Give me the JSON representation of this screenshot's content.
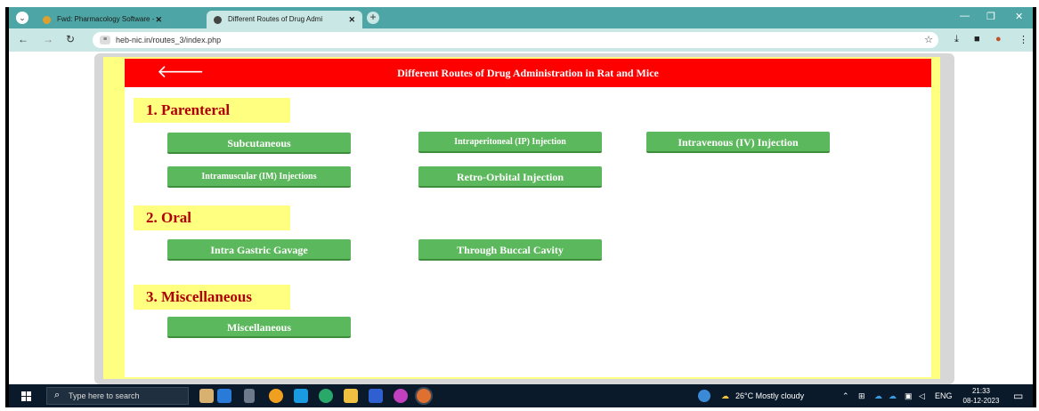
{
  "browser": {
    "tabs": [
      {
        "label": "Fwd: Pharmacology Software - ",
        "close": "✕"
      },
      {
        "label": "Different Routes of Drug Admi",
        "close": "✕"
      }
    ],
    "new_tab": "+",
    "url": "heb-nic.in/routes_3/index.php",
    "window_controls": {
      "minimize": "—",
      "maximize": "❐",
      "close": "✕"
    }
  },
  "page": {
    "title": "Different Routes of Drug Administration in Rat and Mice",
    "back_icon": "arrow-left-icon",
    "sections": [
      {
        "heading": "1. Parenteral",
        "buttons": [
          "Subcutaneous",
          "Intraperitoneal (IP) Injection",
          "Intravenous (IV) Injection",
          "Intramuscular (IM) Injections",
          "Retro-Orbital Injection"
        ]
      },
      {
        "heading": "2. Oral",
        "buttons": [
          "Intra Gastric Gavage",
          "Through Buccal Cavity"
        ]
      },
      {
        "heading": "3. Miscellaneous",
        "buttons": [
          "Miscellaneous"
        ]
      }
    ]
  },
  "taskbar": {
    "search_placeholder": "Type here to search",
    "weather": "26°C  Mostly cloudy",
    "language": "ENG",
    "time": "21:33",
    "date": "08-12-2023"
  },
  "colors": {
    "header_red": "#ff0000",
    "section_bg": "#ffff80",
    "section_text": "#b00000",
    "button_green": "#5cb85c",
    "browser_teal": "#4ea5a5"
  }
}
